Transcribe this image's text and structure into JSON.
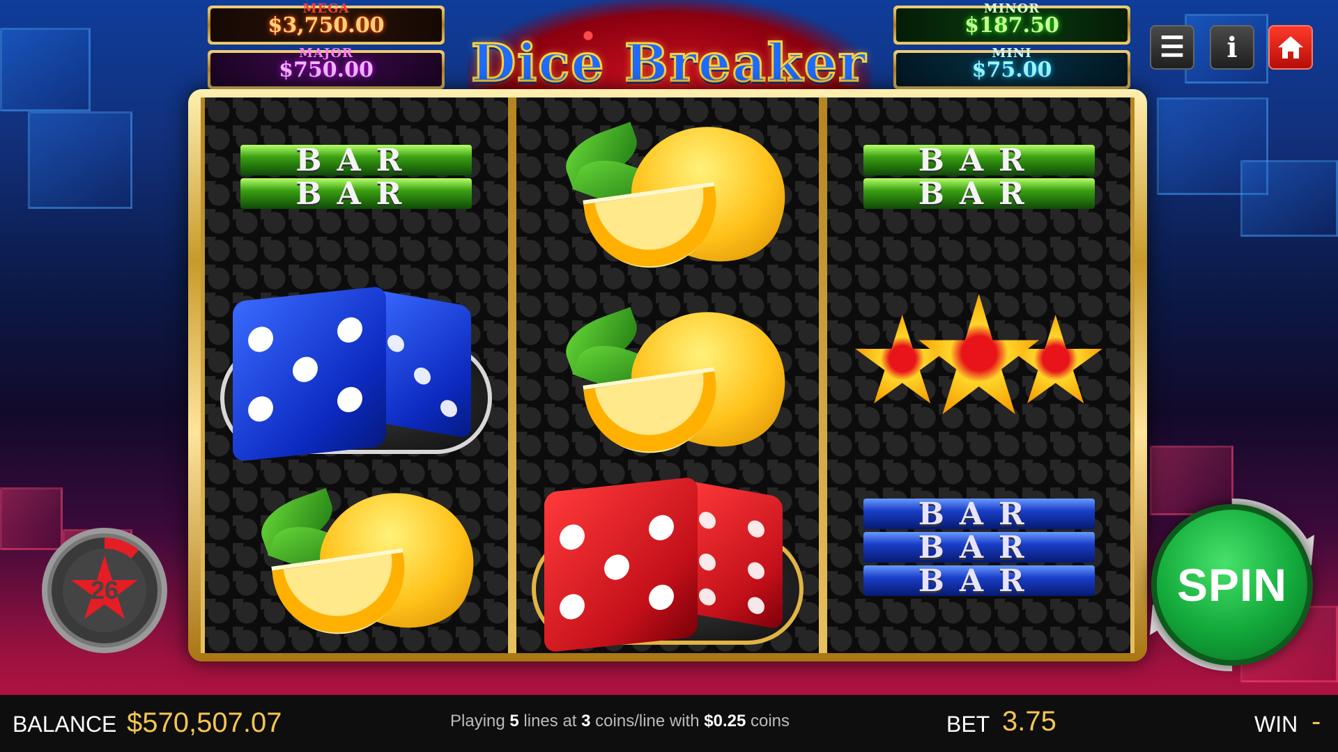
{
  "jackpots": {
    "mega": {
      "label": "MEGA",
      "value": "$3,750.00"
    },
    "major": {
      "label": "MAJOR",
      "value": "$750.00"
    },
    "minor": {
      "label": "MINOR",
      "value": "$187.50"
    },
    "mini": {
      "label": "MINI",
      "value": "$75.00"
    }
  },
  "logo": {
    "title": "Dice Breaker"
  },
  "top_buttons": {
    "menu_icon": "menu-icon",
    "info_icon": "info-icon",
    "home_icon": "home-icon"
  },
  "reels": [
    [
      "bar-2-green",
      "dice-blue",
      "lemon"
    ],
    [
      "lemon",
      "lemon",
      "dice-red"
    ],
    [
      "bar-2-green",
      "stars-3",
      "bar-3-blue"
    ]
  ],
  "bar_text": "BAR",
  "autoplay": {
    "count": "26"
  },
  "spin": {
    "label": "SPIN"
  },
  "bottom": {
    "balance_label": "BALANCE",
    "balance_value": "$570,507.07",
    "lines_prefix": "Playing",
    "lines_count": "5",
    "lines_mid1": "lines at",
    "coins_count": "3",
    "lines_mid2": "coins/line with",
    "coin_value": "$0.25",
    "lines_suffix": "coins",
    "bet_label": "BET",
    "bet_value": "3.75",
    "win_label": "WIN",
    "win_value": "-"
  }
}
